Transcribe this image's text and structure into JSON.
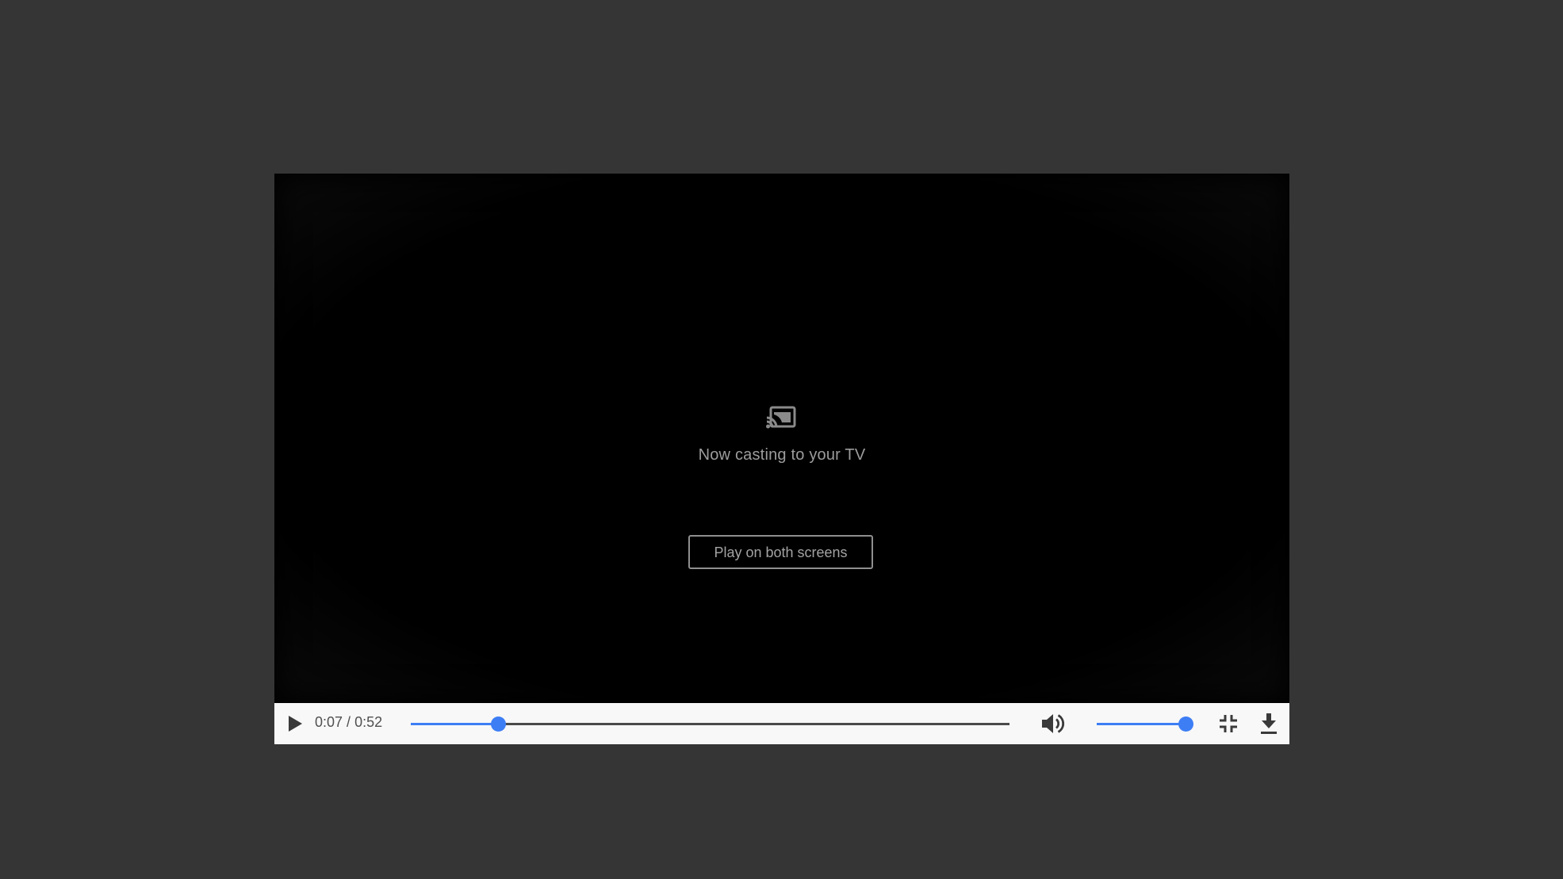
{
  "cast": {
    "icon": "cast-connected-icon",
    "message": "Now casting to your TV",
    "play_both_label": "Play on both screens"
  },
  "controls": {
    "play_icon": "play-icon",
    "current_time": "0:07",
    "separator": "/",
    "duration": "0:52",
    "seek_progress": 0.146,
    "volume_icon": "volume-up-icon",
    "volume_level": 1.0,
    "exit_fullscreen_icon": "fullscreen-exit-icon",
    "download_icon": "download-icon"
  },
  "colors": {
    "page_background": "#353535",
    "accent": "#3d7ef5",
    "control_bar": "#f8f8f8",
    "cast_text": "#9c9c9c"
  }
}
